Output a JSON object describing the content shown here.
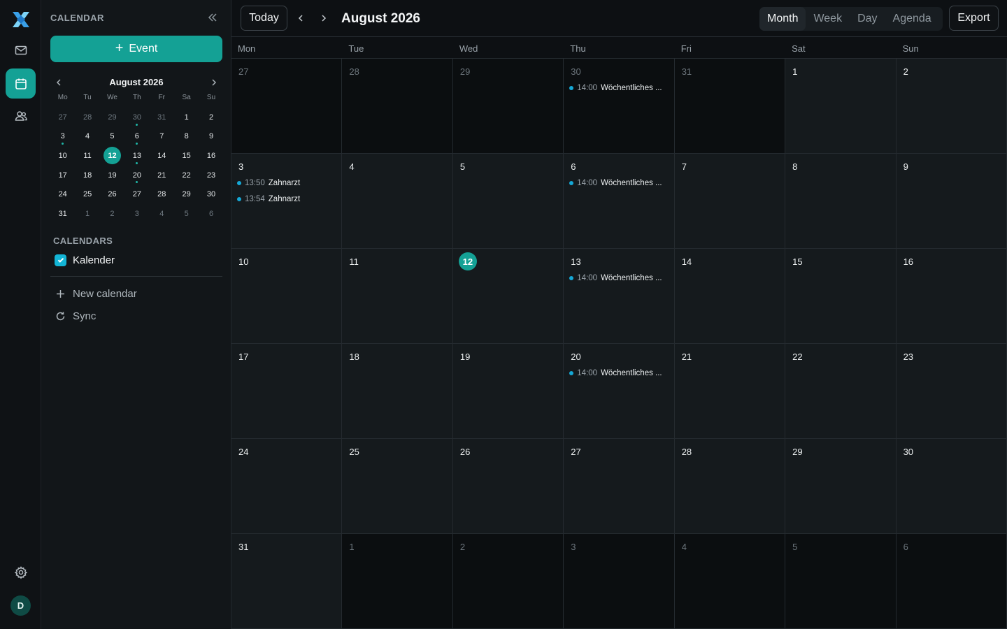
{
  "sidebar": {
    "title": "CALENDAR",
    "event_button": "Event",
    "mini": {
      "month_label": "August 2026",
      "dow": [
        "Mo",
        "Tu",
        "We",
        "Th",
        "Fr",
        "Sa",
        "Su"
      ],
      "days": [
        {
          "d": "27",
          "muted": true
        },
        {
          "d": "28",
          "muted": true
        },
        {
          "d": "29",
          "muted": true
        },
        {
          "d": "30",
          "muted": true,
          "dot": true
        },
        {
          "d": "31",
          "muted": true
        },
        {
          "d": "1"
        },
        {
          "d": "2"
        },
        {
          "d": "3",
          "dot": true
        },
        {
          "d": "4"
        },
        {
          "d": "5"
        },
        {
          "d": "6",
          "dot": true
        },
        {
          "d": "7"
        },
        {
          "d": "8"
        },
        {
          "d": "9"
        },
        {
          "d": "10"
        },
        {
          "d": "11"
        },
        {
          "d": "12",
          "today": true
        },
        {
          "d": "13",
          "dot": true
        },
        {
          "d": "14"
        },
        {
          "d": "15"
        },
        {
          "d": "16"
        },
        {
          "d": "17"
        },
        {
          "d": "18"
        },
        {
          "d": "19"
        },
        {
          "d": "20",
          "dot": true
        },
        {
          "d": "21"
        },
        {
          "d": "22"
        },
        {
          "d": "23"
        },
        {
          "d": "24"
        },
        {
          "d": "25"
        },
        {
          "d": "26"
        },
        {
          "d": "27"
        },
        {
          "d": "28"
        },
        {
          "d": "29"
        },
        {
          "d": "30"
        },
        {
          "d": "31"
        },
        {
          "d": "1",
          "muted": true
        },
        {
          "d": "2",
          "muted": true
        },
        {
          "d": "3",
          "muted": true
        },
        {
          "d": "4",
          "muted": true
        },
        {
          "d": "5",
          "muted": true
        },
        {
          "d": "6",
          "muted": true
        }
      ]
    },
    "calendars_heading": "CALENDARS",
    "calendar_item": "Kalender",
    "new_calendar": "New calendar",
    "sync": "Sync"
  },
  "avatar_initial": "D",
  "toolbar": {
    "today": "Today",
    "title": "August 2026",
    "views": [
      "Month",
      "Week",
      "Day",
      "Agenda"
    ],
    "active_view": "Month",
    "export": "Export"
  },
  "weekdays": [
    "Mon",
    "Tue",
    "Wed",
    "Thu",
    "Fri",
    "Sat",
    "Sun"
  ],
  "weeks": [
    [
      {
        "d": "27",
        "out": true
      },
      {
        "d": "28",
        "out": true
      },
      {
        "d": "29",
        "out": true
      },
      {
        "d": "30",
        "out": true,
        "events": [
          {
            "time": "14:00",
            "title": "Wöchentliches ..."
          }
        ]
      },
      {
        "d": "31",
        "out": true
      },
      {
        "d": "1"
      },
      {
        "d": "2"
      }
    ],
    [
      {
        "d": "3",
        "events": [
          {
            "time": "13:50",
            "title": "Zahnarzt"
          },
          {
            "time": "13:54",
            "title": "Zahnarzt"
          }
        ]
      },
      {
        "d": "4"
      },
      {
        "d": "5"
      },
      {
        "d": "6",
        "events": [
          {
            "time": "14:00",
            "title": "Wöchentliches ..."
          }
        ]
      },
      {
        "d": "7"
      },
      {
        "d": "8"
      },
      {
        "d": "9"
      }
    ],
    [
      {
        "d": "10"
      },
      {
        "d": "11"
      },
      {
        "d": "12",
        "today": true
      },
      {
        "d": "13",
        "events": [
          {
            "time": "14:00",
            "title": "Wöchentliches ..."
          }
        ]
      },
      {
        "d": "14"
      },
      {
        "d": "15"
      },
      {
        "d": "16"
      }
    ],
    [
      {
        "d": "17"
      },
      {
        "d": "18"
      },
      {
        "d": "19"
      },
      {
        "d": "20",
        "events": [
          {
            "time": "14:00",
            "title": "Wöchentliches ..."
          }
        ]
      },
      {
        "d": "21"
      },
      {
        "d": "22"
      },
      {
        "d": "23"
      }
    ],
    [
      {
        "d": "24"
      },
      {
        "d": "25"
      },
      {
        "d": "26"
      },
      {
        "d": "27"
      },
      {
        "d": "28"
      },
      {
        "d": "29"
      },
      {
        "d": "30"
      }
    ],
    [
      {
        "d": "31"
      },
      {
        "d": "1",
        "out": true
      },
      {
        "d": "2",
        "out": true
      },
      {
        "d": "3",
        "out": true
      },
      {
        "d": "4",
        "out": true
      },
      {
        "d": "5",
        "out": true
      },
      {
        "d": "6",
        "out": true
      }
    ]
  ],
  "colors": {
    "accent": "#14a195",
    "event_dot": "#15a8d6",
    "checkbox": "#13b5d6"
  }
}
